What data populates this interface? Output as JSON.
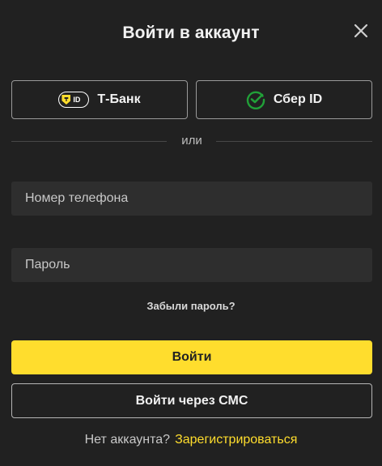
{
  "dialog": {
    "title": "Войти в аккаунт"
  },
  "providers": {
    "tbank": {
      "label": "Т-Банк",
      "badge_text": "ID",
      "icon": "tbank-id-icon"
    },
    "sber": {
      "label": "Сбер ID",
      "icon": "sber-check-icon"
    }
  },
  "divider": {
    "text": "или"
  },
  "form": {
    "phone_placeholder": "Номер телефона",
    "password_placeholder": "Пароль",
    "forgot_label": "Забыли пароль?",
    "login_label": "Войти",
    "sms_label": "Войти через СМС"
  },
  "footer": {
    "question": "Нет аккаунта?",
    "register_label": "Зарегистрироваться"
  },
  "colors": {
    "background": "#212121",
    "accent": "#ffdd2d",
    "sber_green": "#21a038"
  }
}
